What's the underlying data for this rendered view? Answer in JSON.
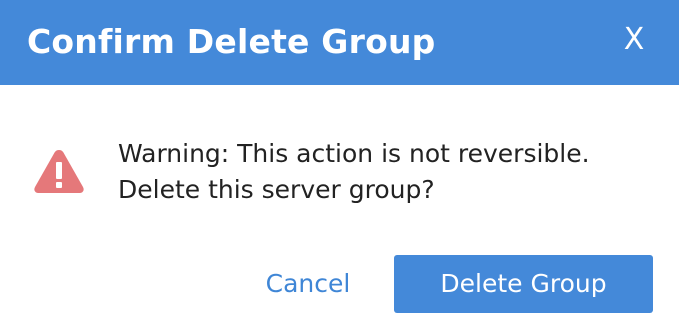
{
  "dialog": {
    "title": "Confirm Delete Group",
    "close_label": "X",
    "warning_line1": "Warning: This action is not reversible.",
    "warning_line2": "Delete this server group?",
    "cancel_label": "Cancel",
    "delete_label": "Delete Group",
    "icon": "warning-triangle-icon"
  },
  "colors": {
    "header": "#4489d9",
    "primary_button": "#4489d9",
    "link": "#3f86d6",
    "warning_icon": "#e5787a"
  }
}
